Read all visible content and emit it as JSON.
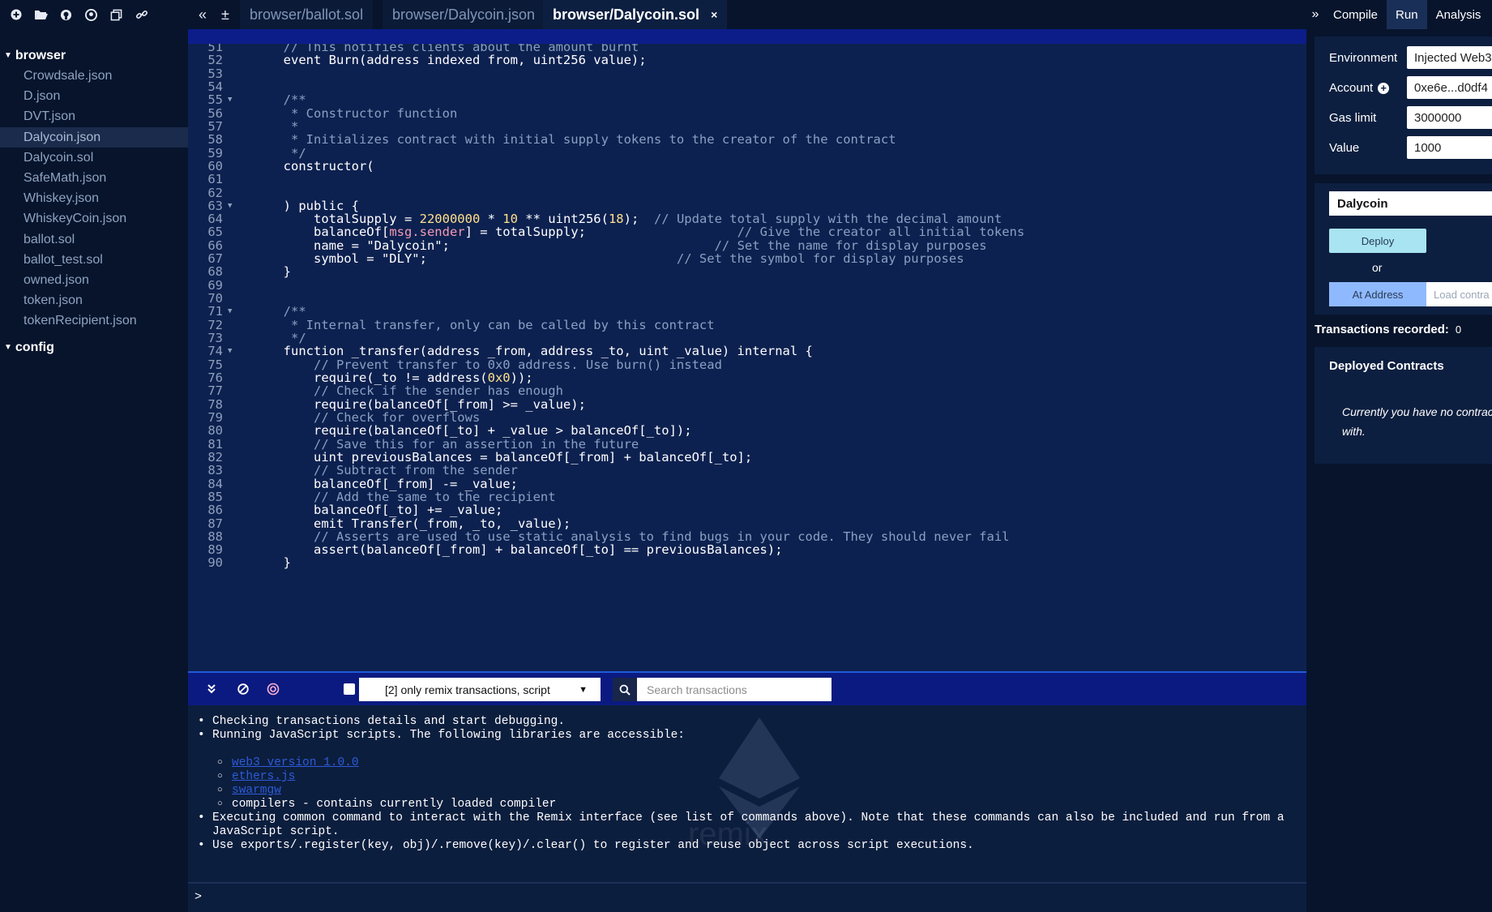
{
  "file_explorer": {
    "toolbar_icons": [
      "plus-icon",
      "folder-open-icon",
      "github-icon",
      "github-alt-icon",
      "copy-icon",
      "link-icon"
    ],
    "folders": [
      {
        "name": "browser",
        "files": [
          "Crowdsale.json",
          "D.json",
          "DVT.json",
          "Dalycoin.json",
          "Dalycoin.sol",
          "SafeMath.json",
          "Whiskey.json",
          "WhiskeyCoin.json",
          "ballot.sol",
          "ballot_test.sol",
          "owned.json",
          "token.json",
          "tokenRecipient.json"
        ]
      },
      {
        "name": "config",
        "files": []
      }
    ],
    "active_file": "Dalycoin.json"
  },
  "tabs": {
    "items": [
      "browser/ballot.sol",
      "browser/Dalycoin.json",
      "browser/Dalycoin.sol"
    ],
    "active": "browser/Dalycoin.sol",
    "close": "×"
  },
  "right_panel": {
    "tabs": [
      "Compile",
      "Run",
      "Analysis"
    ],
    "active_tab": "Run",
    "environment_label": "Environment",
    "environment_value": "Injected Web3",
    "account_label": "Account",
    "account_value": "0xe6e...d0df4",
    "gas_limit_label": "Gas limit",
    "gas_limit_value": "3000000",
    "value_label": "Value",
    "value_value": "1000",
    "contract": "Dalycoin",
    "deploy": "Deploy",
    "or": "or",
    "at_address": "At Address",
    "load_contract": "Load contra",
    "tx_recorded_label": "Transactions recorded:",
    "tx_recorded_count": "0",
    "deployed_title": "Deployed Contracts",
    "deployed_empty": "Currently you have no contract with."
  },
  "editor": {
    "lines": [
      {
        "n": "51",
        "fold": false,
        "parts": [
          [
            "cm",
            "        // This notifies clients about the amount burnt"
          ]
        ]
      },
      {
        "n": "52",
        "fold": false,
        "parts": [
          [
            "kw",
            "        event Burn(address indexed from, uint256 value);"
          ]
        ]
      },
      {
        "n": "53",
        "fold": false,
        "parts": []
      },
      {
        "n": "54",
        "fold": false,
        "parts": []
      },
      {
        "n": "55",
        "fold": true,
        "parts": [
          [
            "cm",
            "        /**"
          ]
        ]
      },
      {
        "n": "56",
        "fold": false,
        "parts": [
          [
            "cm",
            "         * Constructor function"
          ]
        ]
      },
      {
        "n": "57",
        "fold": false,
        "parts": [
          [
            "cm",
            "         *"
          ]
        ]
      },
      {
        "n": "58",
        "fold": false,
        "parts": [
          [
            "cm",
            "         * Initializes contract with initial supply tokens to the creator of the contract"
          ]
        ]
      },
      {
        "n": "59",
        "fold": false,
        "parts": [
          [
            "cm",
            "         */"
          ]
        ]
      },
      {
        "n": "60",
        "fold": false,
        "parts": [
          [
            "kw",
            "        constructor("
          ]
        ]
      },
      {
        "n": "61",
        "fold": false,
        "parts": []
      },
      {
        "n": "62",
        "fold": false,
        "parts": []
      },
      {
        "n": "63",
        "fold": true,
        "parts": [
          [
            "kw",
            "        ) public {"
          ]
        ]
      },
      {
        "n": "64",
        "fold": false,
        "parts": [
          [
            "kw",
            "            totalSupply = "
          ],
          [
            "num",
            "22000000"
          ],
          [
            "kw",
            " * "
          ],
          [
            "num",
            "10"
          ],
          [
            "kw",
            " ** uint256("
          ],
          [
            "num",
            "18"
          ],
          [
            "kw",
            ");  "
          ],
          [
            "cm",
            "// Update total supply with the decimal amount"
          ]
        ]
      },
      {
        "n": "65",
        "fold": false,
        "parts": [
          [
            "kw",
            "            balanceOf["
          ],
          [
            "hl",
            "msg.sender"
          ],
          [
            "kw",
            "] = totalSupply;                "
          ],
          [
            "cm",
            "    // Give the creator all initial tokens"
          ]
        ]
      },
      {
        "n": "66",
        "fold": false,
        "parts": [
          [
            "kw",
            "            name = "
          ],
          [
            "str",
            "\"Dalycoin\""
          ],
          [
            "kw",
            ";                                   "
          ],
          [
            "cm",
            "// Set the name for display purposes"
          ]
        ]
      },
      {
        "n": "67",
        "fold": false,
        "parts": [
          [
            "kw",
            "            symbol = "
          ],
          [
            "str",
            "\"DLY\""
          ],
          [
            "kw",
            ";                        "
          ],
          [
            "cm",
            "         // Set the symbol for display purposes"
          ]
        ]
      },
      {
        "n": "68",
        "fold": false,
        "parts": [
          [
            "kw",
            "        }"
          ]
        ]
      },
      {
        "n": "69",
        "fold": false,
        "parts": []
      },
      {
        "n": "70",
        "fold": false,
        "parts": []
      },
      {
        "n": "71",
        "fold": true,
        "parts": [
          [
            "cm",
            "        /**"
          ]
        ]
      },
      {
        "n": "72",
        "fold": false,
        "parts": [
          [
            "cm",
            "         * Internal transfer, only can be called by this contract"
          ]
        ]
      },
      {
        "n": "73",
        "fold": false,
        "parts": [
          [
            "cm",
            "         */"
          ]
        ]
      },
      {
        "n": "74",
        "fold": true,
        "parts": [
          [
            "kw",
            "        function _transfer(address _from, address _to, uint _value) internal {"
          ]
        ]
      },
      {
        "n": "75",
        "fold": false,
        "parts": [
          [
            "cm",
            "            // Prevent transfer to 0x0 address. Use burn() instead"
          ]
        ]
      },
      {
        "n": "76",
        "fold": false,
        "parts": [
          [
            "kw",
            "            require(_to != address("
          ],
          [
            "num",
            "0x0"
          ],
          [
            "kw",
            "));"
          ]
        ]
      },
      {
        "n": "77",
        "fold": false,
        "parts": [
          [
            "cm",
            "            // Check if the sender has enough"
          ]
        ]
      },
      {
        "n": "78",
        "fold": false,
        "parts": [
          [
            "kw",
            "            require(balanceOf[_from] >= _value);"
          ]
        ]
      },
      {
        "n": "79",
        "fold": false,
        "parts": [
          [
            "cm",
            "            // Check for overflows"
          ]
        ]
      },
      {
        "n": "80",
        "fold": false,
        "parts": [
          [
            "kw",
            "            require(balanceOf[_to] + _value > balanceOf[_to]);"
          ]
        ]
      },
      {
        "n": "81",
        "fold": false,
        "parts": [
          [
            "cm",
            "            // Save this for an assertion in the future"
          ]
        ]
      },
      {
        "n": "82",
        "fold": false,
        "parts": [
          [
            "kw",
            "            uint previousBalances = balanceOf[_from] + balanceOf[_to];"
          ]
        ]
      },
      {
        "n": "83",
        "fold": false,
        "parts": [
          [
            "cm",
            "            // Subtract from the sender"
          ]
        ]
      },
      {
        "n": "84",
        "fold": false,
        "parts": [
          [
            "kw",
            "            balanceOf[_from] -= _value;"
          ]
        ]
      },
      {
        "n": "85",
        "fold": false,
        "parts": [
          [
            "cm",
            "            // Add the same to the recipient"
          ]
        ]
      },
      {
        "n": "86",
        "fold": false,
        "parts": [
          [
            "kw",
            "            balanceOf[_to] += _value;"
          ]
        ]
      },
      {
        "n": "87",
        "fold": false,
        "parts": [
          [
            "kw",
            "            emit Transfer(_from, _to, _value);"
          ]
        ]
      },
      {
        "n": "88",
        "fold": false,
        "parts": [
          [
            "cm",
            "            // Asserts are used to use static analysis to find bugs in your code. They should never fail"
          ]
        ]
      },
      {
        "n": "89",
        "fold": false,
        "parts": [
          [
            "kw",
            "            assert(balanceOf[_from] + balanceOf[_to] == previousBalances);"
          ]
        ]
      },
      {
        "n": "90",
        "fold": false,
        "parts": [
          [
            "kw",
            "        }"
          ]
        ]
      }
    ]
  },
  "terminal": {
    "filter": "[2] only remix transactions, script",
    "search_placeholder": "Search transactions",
    "bullets": [
      "Checking transactions details and start debugging.",
      "Running JavaScript scripts. The following libraries are accessible:"
    ],
    "sub_bullets_links": [
      "web3 version 1.0.0",
      "ethers.js",
      "swarmgw"
    ],
    "sub_bullet_text": "compilers - contains currently loaded compiler",
    "bullets_after": [
      "Executing common command to interact with the Remix interface (see list of commands above). Note that these commands can also be included and run from a JavaScript script.",
      "Use exports/.register(key, obj)/.remove(key)/.clear() to register and reuse object across script executions."
    ],
    "watermark": "remix",
    "prompt": ">"
  }
}
